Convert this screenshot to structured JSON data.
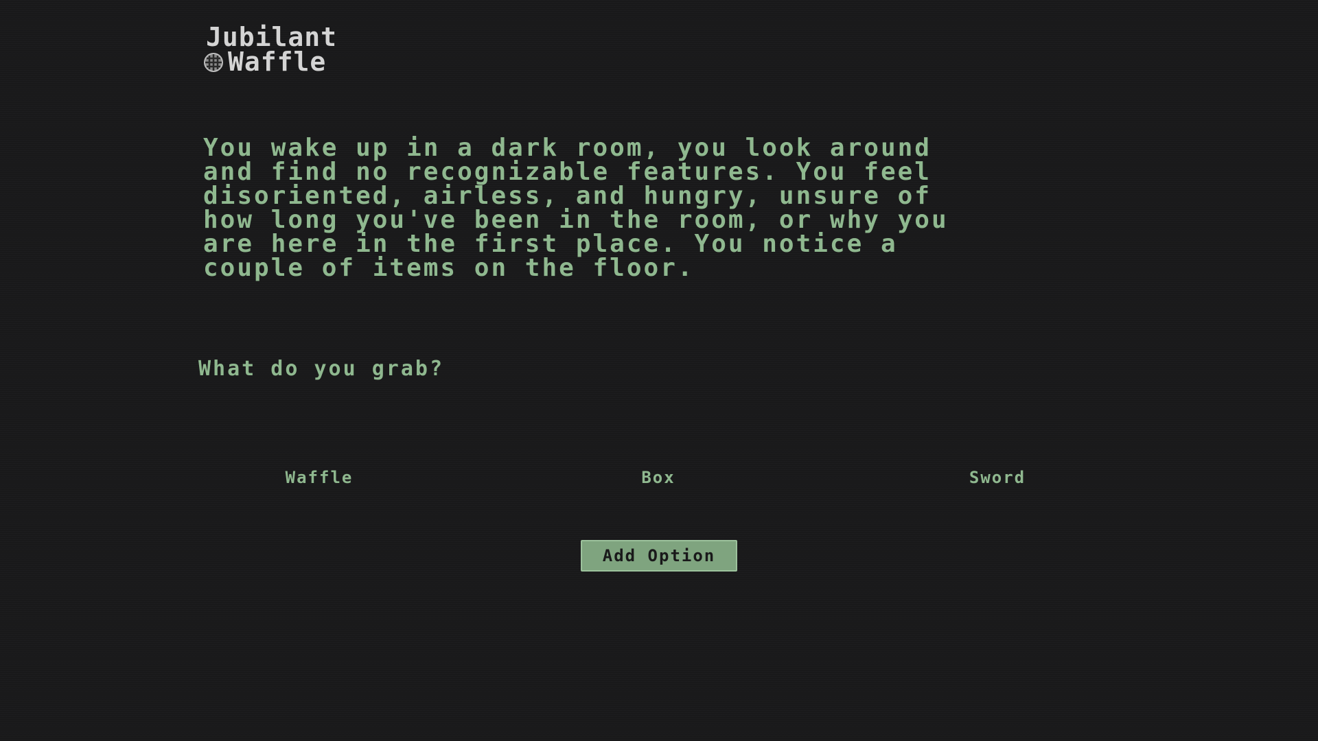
{
  "logo": {
    "line1": "Jubilant",
    "line2": "Waffle",
    "icon": "waffle-icon"
  },
  "story": {
    "text": "You wake up in a dark room, you look around\nand find no recognizable features. You feel\ndisoriented, airless, and hungry, unsure of\nhow long you've been in the room, or why you\nare here in the first place. You notice a\ncouple of items on the floor."
  },
  "prompt": {
    "question": "What do you grab?"
  },
  "options": [
    {
      "label": "Waffle"
    },
    {
      "label": "Box"
    },
    {
      "label": "Sword"
    }
  ],
  "actions": {
    "add_option_label": "Add Option"
  },
  "colors": {
    "background": "#19191a",
    "text_green": "#8fb88f",
    "button_green": "#7fa47f",
    "logo_gray": "#d4d4d4"
  }
}
